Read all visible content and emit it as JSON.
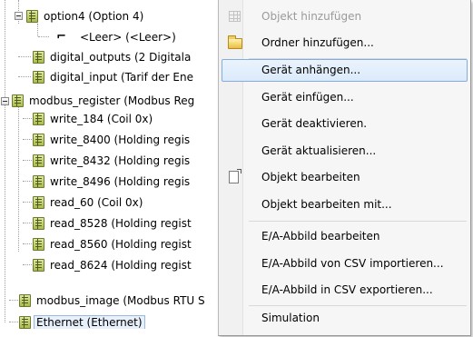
{
  "tree": {
    "nodes": [
      {
        "label": "option4 (Option 4)",
        "icon": "field-icon"
      },
      {
        "label": "<Leer> (<Leer>)",
        "icon": "empty-entry-icon"
      },
      {
        "label": "digital_outputs (2 Digitala",
        "icon": "field-icon"
      },
      {
        "label": "digital_input (Tarif der Ene",
        "icon": "field-icon"
      },
      {
        "label": "modbus_register (Modbus Reg",
        "icon": "field-icon"
      },
      {
        "label": "write_184 (Coil 0x)",
        "icon": "field-icon"
      },
      {
        "label": "write_8400 (Holding regis",
        "icon": "field-icon"
      },
      {
        "label": "write_8432 (Holding regis",
        "icon": "field-icon"
      },
      {
        "label": "write_8496 (Holding regis",
        "icon": "field-icon"
      },
      {
        "label": "read_60 (Coil 0x)",
        "icon": "field-icon"
      },
      {
        "label": "read_8528 (Holding regist",
        "icon": "field-icon"
      },
      {
        "label": "read_8560 (Holding regist",
        "icon": "field-icon"
      },
      {
        "label": "read_8624 (Holding regist",
        "icon": "field-icon"
      },
      {
        "label": "modbus_image (Modbus RTU S",
        "icon": "field-icon"
      },
      {
        "label": "Ethernet (Ethernet)",
        "icon": "field-icon",
        "selected": true
      }
    ]
  },
  "menu": {
    "items": [
      {
        "label": "Objekt hinzufügen",
        "disabled": true,
        "icon": "grid-icon"
      },
      {
        "label": "Ordner hinzufügen...",
        "icon": "folder-icon"
      },
      {
        "label": "Gerät anhängen...",
        "highlighted": true
      },
      {
        "label": "Gerät einfügen..."
      },
      {
        "label": "Gerät deaktivieren."
      },
      {
        "label": "Gerät aktualisieren..."
      },
      {
        "label": "Objekt bearbeiten",
        "icon": "edit-icon"
      },
      {
        "label": "Objekt bearbeiten mit..."
      },
      {
        "label": "E/A-Abbild bearbeiten"
      },
      {
        "label": "E/A-Abbild von CSV importieren..."
      },
      {
        "label": "E/A-Abbild in CSV exportieren..."
      },
      {
        "label": "Simulation"
      }
    ]
  }
}
